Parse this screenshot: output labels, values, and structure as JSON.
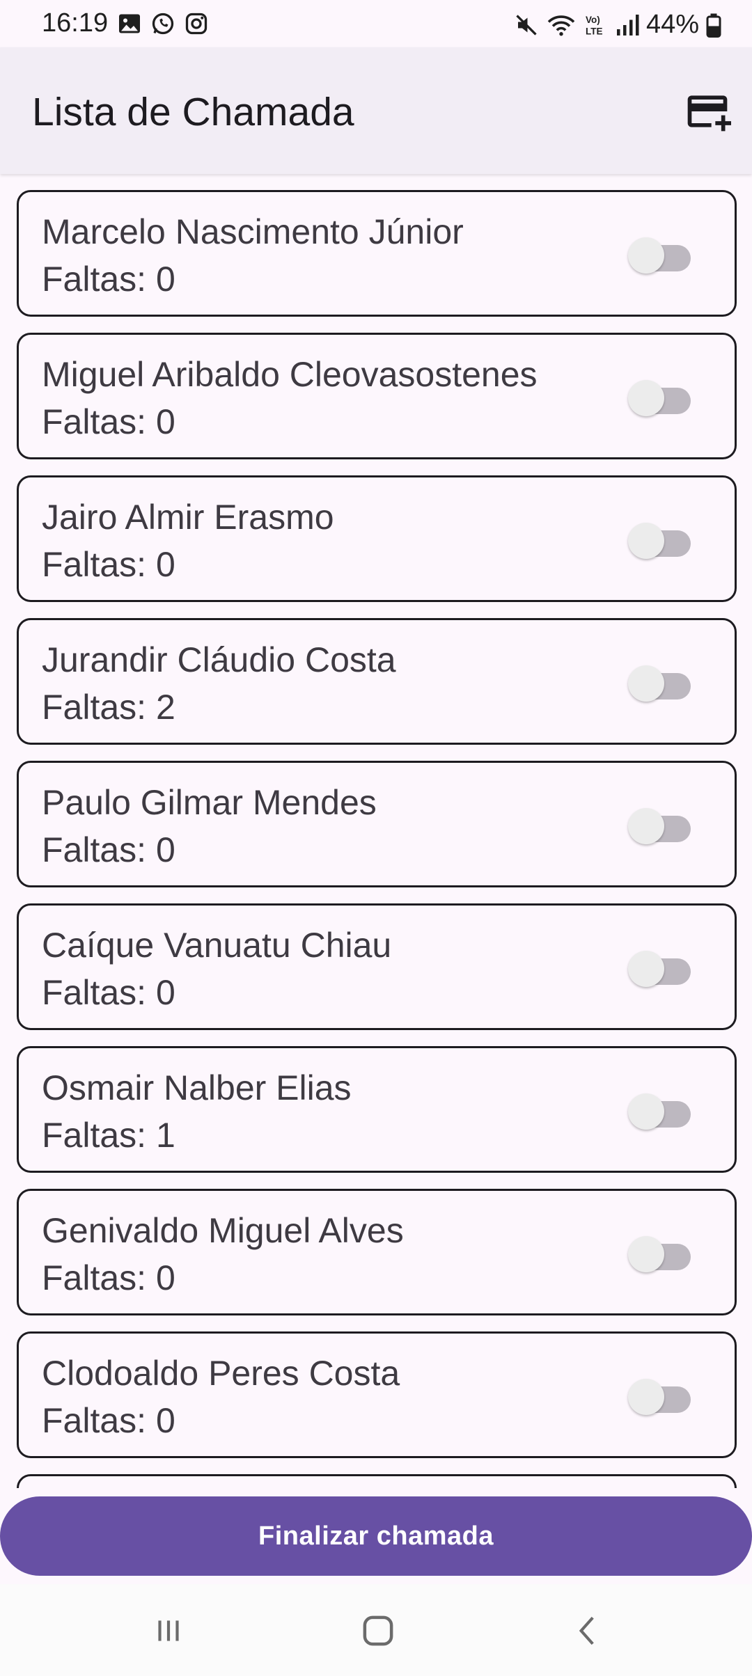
{
  "status_bar": {
    "time": "16:19",
    "battery": "44%",
    "left_icons": [
      "gallery-icon",
      "whatsapp-icon",
      "instagram-icon"
    ],
    "right_icons": [
      "mute-icon",
      "wifi-icon",
      "volte-icon",
      "signal-icon",
      "battery-icon"
    ]
  },
  "app_bar": {
    "title": "Lista de Chamada",
    "action_icon": "add-card-icon"
  },
  "students": [
    {
      "name": "Marcelo Nascimento Júnior",
      "faltas": "Faltas: 0",
      "present": false
    },
    {
      "name": "Miguel Aribaldo Cleovasostenes",
      "faltas": "Faltas: 0",
      "present": false
    },
    {
      "name": "Jairo Almir Erasmo",
      "faltas": "Faltas: 0",
      "present": false
    },
    {
      "name": "Jurandir Cláudio Costa",
      "faltas": "Faltas: 2",
      "present": false
    },
    {
      "name": "Paulo Gilmar Mendes",
      "faltas": "Faltas: 0",
      "present": false
    },
    {
      "name": "Caíque Vanuatu Chiau",
      "faltas": "Faltas: 0",
      "present": false
    },
    {
      "name": "Osmair Nalber Elias",
      "faltas": "Faltas: 1",
      "present": false
    },
    {
      "name": "Genivaldo Miguel Alves",
      "faltas": "Faltas: 0",
      "present": false
    },
    {
      "name": "Clodoaldo Peres Costa",
      "faltas": "Faltas: 0",
      "present": false
    }
  ],
  "finalize_button": {
    "label": "Finalizar chamada"
  },
  "nav_bar": {
    "items": [
      "recents-icon",
      "home-icon",
      "back-icon"
    ]
  },
  "colors": {
    "accent": "#6750a4",
    "background": "#fdf7fd",
    "app_bar": "#f2edf5"
  }
}
